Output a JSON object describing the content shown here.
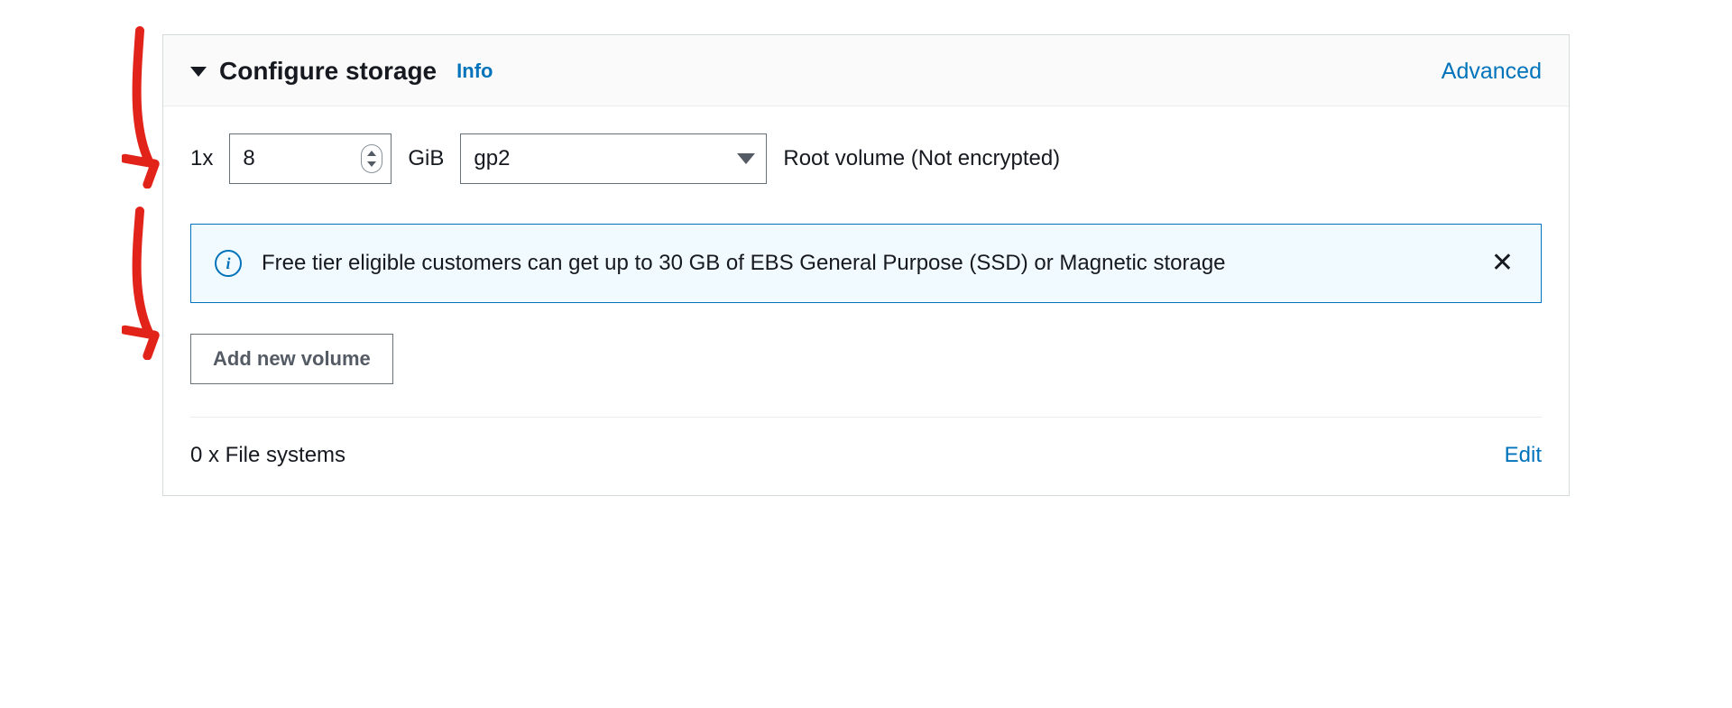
{
  "header": {
    "title": "Configure storage",
    "info_label": "Info",
    "advanced_label": "Advanced"
  },
  "volume": {
    "quantity_prefix": "1x",
    "size_value": "8",
    "size_unit": "GiB",
    "type_selected": "gp2",
    "description": "Root volume  (Not encrypted)"
  },
  "info_banner": {
    "text": "Free tier eligible customers can get up to 30 GB of EBS General Purpose (SSD) or Magnetic storage"
  },
  "buttons": {
    "add_volume": "Add new volume"
  },
  "filesystems": {
    "label": "0 x File systems",
    "edit_label": "Edit"
  }
}
